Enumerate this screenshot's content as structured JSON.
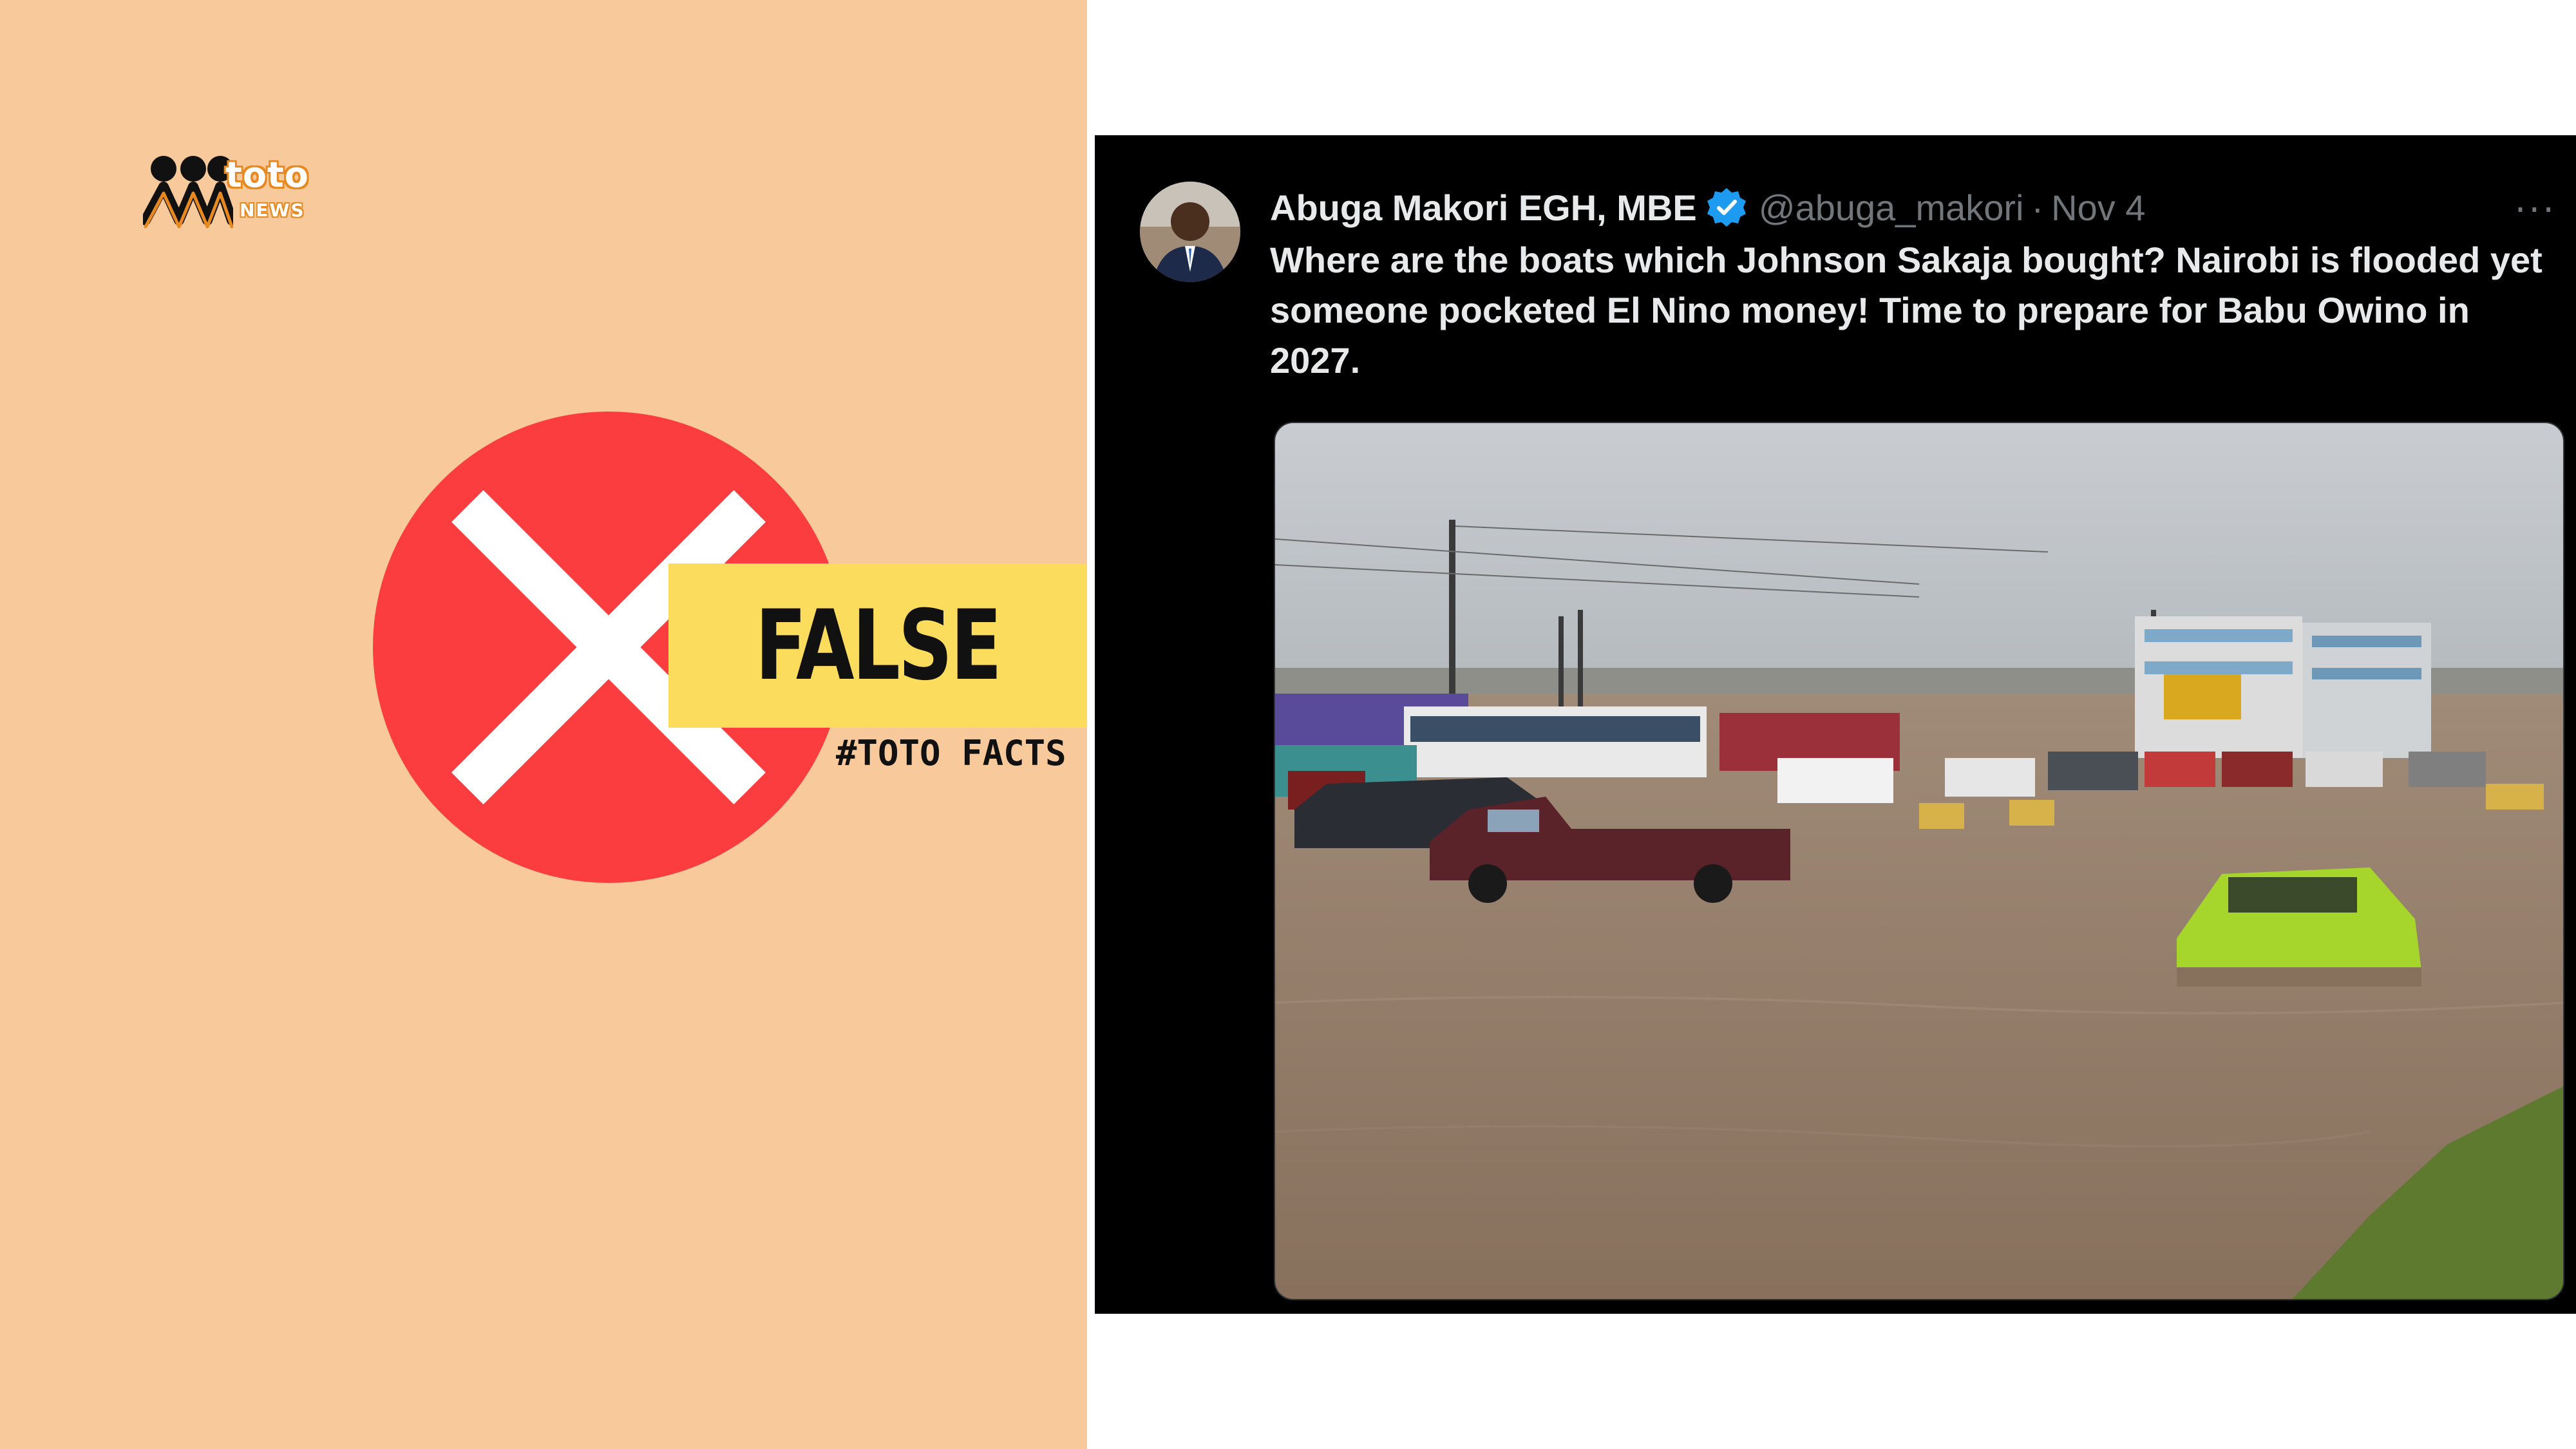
{
  "brand": {
    "logo_word": "toto",
    "logo_sub": "NEWS",
    "accent_color": "#e8891f"
  },
  "verdict": {
    "label": "FALSE",
    "hashtag": "#TOTO FACTS",
    "icon": "x-mark-icon",
    "circle_color": "#fb3d3f",
    "label_background": "#fcdc5c",
    "panel_background": "#f7c99b"
  },
  "tweet": {
    "author_name": "Abuga Makori EGH, MBE",
    "verified_icon": "verified-badge-icon",
    "handle": "@abuga_makori",
    "separator": "·",
    "date": "Nov 4",
    "more_label": "···",
    "text": "Where are the boats which Johnson Sakaja bought? Nairobi is flooded yet someone pocketed El Nino money! Time to prepare for Babu Owino in 2027."
  }
}
